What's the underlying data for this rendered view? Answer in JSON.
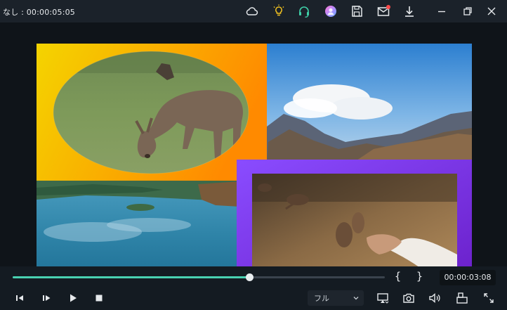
{
  "titlebar": {
    "title": "なし : 00:00:05:05",
    "icons": [
      "cloud-icon",
      "lightbulb-icon",
      "headset-icon",
      "avatar",
      "save-icon",
      "mail-icon",
      "download-icon",
      "minimize-icon",
      "restore-icon",
      "close-icon"
    ],
    "colors": {
      "lightbulb": "#f0c020",
      "headset": "#3fd0a8",
      "notification": "#ff4a4a"
    }
  },
  "preview": {
    "clips": [
      "deer",
      "mountain-lake-sky",
      "lake",
      "sparrows-on-hand"
    ],
    "frame_colors": {
      "deer_gradient": [
        "#f4d400",
        "#ff8a00"
      ],
      "birds_gradient": [
        "#8a4cff",
        "#6a1fc9"
      ]
    }
  },
  "playback": {
    "progress": 0.635,
    "mark_in": "{",
    "mark_out": "}",
    "current_time": "00:00:03:08",
    "accent": "#49d1b1"
  },
  "controls": {
    "buttons": [
      "previous-frame-icon",
      "next-frame-icon",
      "play-icon",
      "stop-icon"
    ],
    "quality_select": {
      "value": "フル"
    },
    "right_buttons": [
      "display-icon",
      "snapshot-icon",
      "volume-icon",
      "layout-icon",
      "fullscreen-icon"
    ]
  }
}
